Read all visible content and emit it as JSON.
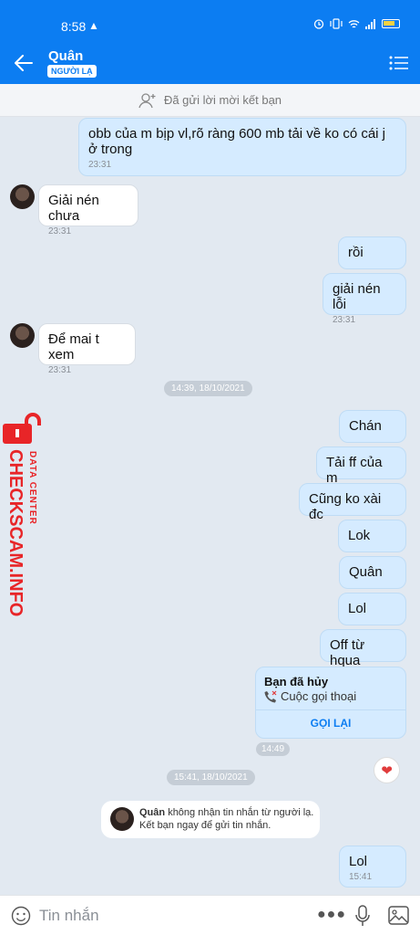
{
  "status": {
    "time": "8:58",
    "warn": "▲"
  },
  "header": {
    "name": "Quân",
    "badge": "NGƯỜI LẠ"
  },
  "friendbar": {
    "text": "Đã gửi lời mời kết bạn"
  },
  "messages": [
    {
      "text": "obb của m bịp vl,rõ ràng 600 mb tải về ko có cái j ở trong",
      "time": "23:31"
    },
    {
      "text": "Giải nén chưa",
      "time": "23:31"
    },
    {
      "text": "rồi"
    },
    {
      "text": "giải nén lỗi",
      "time": "23:31"
    },
    {
      "text": "Để mai t xem",
      "time": "23:31"
    },
    {
      "text": "Chán"
    },
    {
      "text": "Tải ff của m"
    },
    {
      "text": "Cũng ko xài đc"
    },
    {
      "text": "Lok"
    },
    {
      "text": "Quân"
    },
    {
      "text": "Lol"
    },
    {
      "text": "Off từ hqua"
    },
    {
      "text": "Lol",
      "time": "15:41"
    }
  ],
  "dates": [
    "14:39, 18/10/2021",
    "15:41, 18/10/2021"
  ],
  "call": {
    "title": "Bạn đã hủy",
    "subtitle": "Cuộc gọi thoại",
    "button": "GỌI LẠI",
    "time": "14:49"
  },
  "notice": {
    "name": "Quân",
    "text": "không nhận tin nhắn từ người lạ. Kết bạn ngay để gửi tin nhắn."
  },
  "input": {
    "placeholder": "Tin nhắn",
    "more": "●●●"
  },
  "watermark": {
    "big": "CHECKSCAM.INFO",
    "small": "DATA CENTER"
  },
  "colors": {
    "accent": "#0c7df2",
    "my_bubble": "#d5ebff",
    "watermark": "#e82528"
  }
}
